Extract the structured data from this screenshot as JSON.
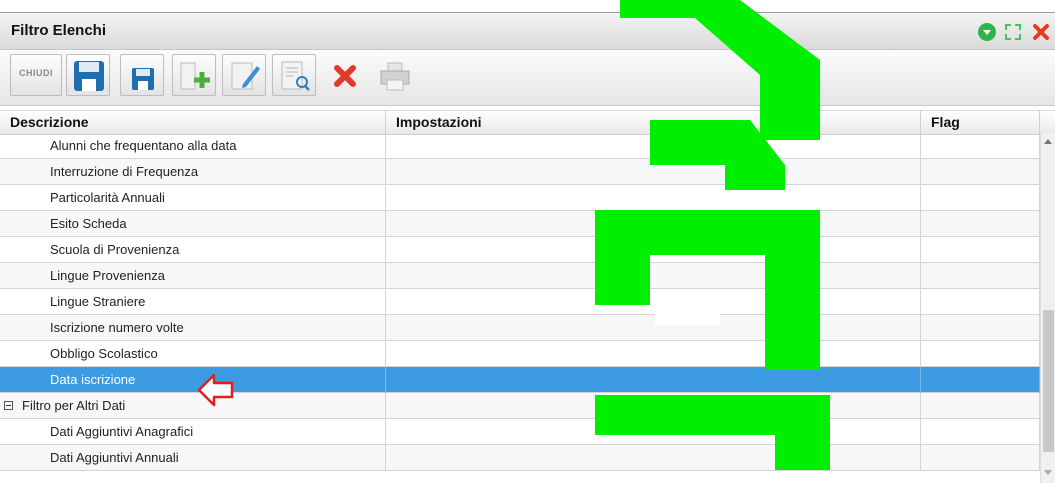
{
  "window": {
    "title": "Filtro Elenchi",
    "controls": [
      "expand-icon",
      "fullscreen-icon",
      "close-icon"
    ]
  },
  "toolbar": {
    "close_label": "CHIUDI",
    "buttons": [
      "save-icon",
      "save-small-icon",
      "add-icon",
      "edit-icon",
      "preview-icon",
      "delete-icon",
      "print-icon"
    ]
  },
  "table": {
    "columns": [
      "Descrizione",
      "Impostazioni",
      "Flag"
    ],
    "rows": [
      {
        "label": "Alunni che frequentano alla data",
        "type": "item"
      },
      {
        "label": "Interruzione di Frequenza",
        "type": "item"
      },
      {
        "label": "Particolarità Annuali",
        "type": "item"
      },
      {
        "label": "Esito Scheda",
        "type": "item"
      },
      {
        "label": "Scuola di Provenienza",
        "type": "item"
      },
      {
        "label": "Lingue Provenienza",
        "type": "item"
      },
      {
        "label": "Lingue Straniere",
        "type": "item"
      },
      {
        "label": "Iscrizione numero volte",
        "type": "item"
      },
      {
        "label": "Obbligo Scolastico",
        "type": "item"
      },
      {
        "label": "Data iscrizione",
        "type": "item",
        "selected": true
      },
      {
        "label": "Filtro per Altri Dati",
        "type": "group"
      },
      {
        "label": "Dati Aggiuntivi Anagrafici",
        "type": "item"
      },
      {
        "label": "Dati Aggiuntivi Annuali",
        "type": "item"
      }
    ]
  },
  "colors": {
    "selection": "#3d9be3",
    "watermark": "#00ee00",
    "pointer_arrow": "#e02020",
    "window_green": "#2fb34a",
    "window_red": "#e8391f"
  }
}
